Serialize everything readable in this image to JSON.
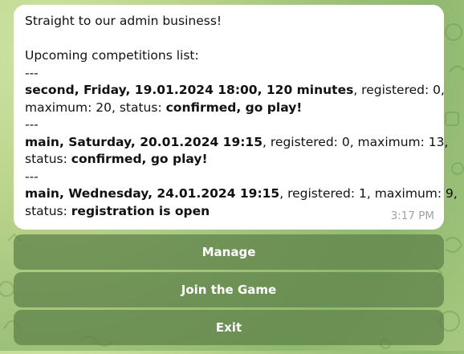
{
  "message": {
    "greeting": "Straight to our admin business!",
    "list_title": "Upcoming competitions list:",
    "separator": "---",
    "competitions": [
      {
        "title": "second, Friday, 19.01.2024 18:00, 120 minutes",
        "registered_text": ", registered: 0,",
        "line2_prefix": "maximum: 20, status: ",
        "status": "confirmed, go play!"
      },
      {
        "title": "main, Saturday, 20.01.2024 19:15",
        "registered_text": ", registered: 0, maximum: 13,",
        "line2_prefix": "status: ",
        "status": "confirmed, go play!"
      },
      {
        "title": "main, Wednesday, 24.01.2024 19:15",
        "registered_text": ", registered: 1, maximum: 9,",
        "line2_prefix": "status: ",
        "status": "registration is open"
      }
    ],
    "time": "3:17 PM"
  },
  "keyboard": {
    "buttons": [
      {
        "label": "Manage"
      },
      {
        "label": "Join the Game"
      },
      {
        "label": "Exit"
      }
    ]
  },
  "colors": {
    "bubble_bg": "#ffffff",
    "button_bg": "#5c8048",
    "button_text": "#ffffff",
    "time_text": "#9aa3ab"
  }
}
